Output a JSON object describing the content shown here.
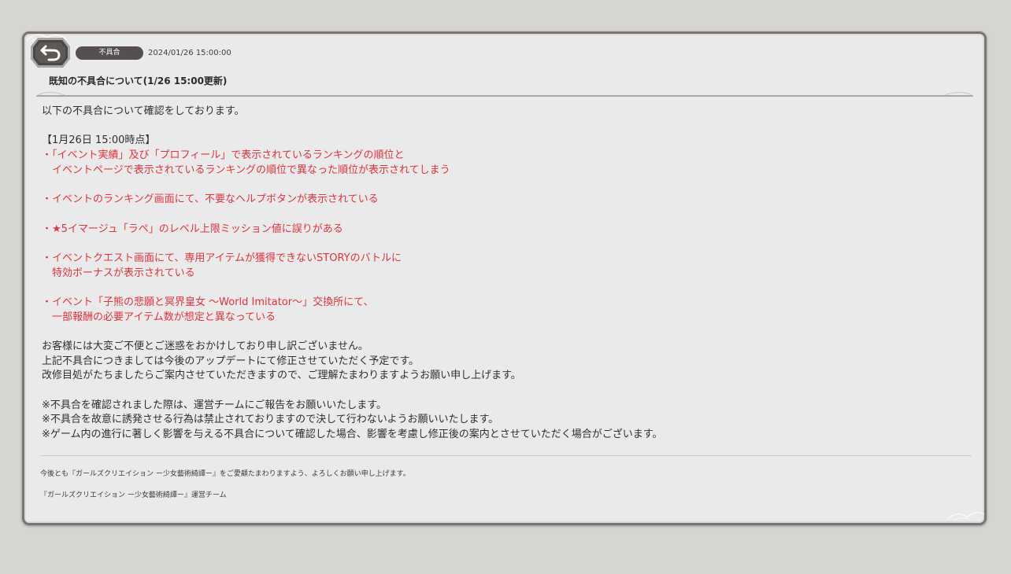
{
  "header": {
    "category_badge": "不具合",
    "date": "2024/01/26 15:00:00",
    "title": "既知の不具合について(1/26 15:00更新)"
  },
  "body": {
    "lines": [
      {
        "text": "以下の不具合について確認をしております。",
        "style": "normal"
      },
      {
        "text": "",
        "style": "normal"
      },
      {
        "text": "【1月26日 15:00時点】",
        "style": "normal"
      },
      {
        "text": "・「イベント実績」及び「プロフィール」で表示されているランキングの順位と",
        "style": "red"
      },
      {
        "text": "　イベントページで表示されているランキングの順位で異なった順位が表示されてしまう",
        "style": "red"
      },
      {
        "text": "",
        "style": "normal"
      },
      {
        "text": "・イベントのランキング画面にて、不要なヘルプボタンが表示されている",
        "style": "red"
      },
      {
        "text": "",
        "style": "normal"
      },
      {
        "text": "・★5イマージュ「ラペ」のレベル上限ミッション値に誤りがある",
        "style": "red"
      },
      {
        "text": "",
        "style": "normal"
      },
      {
        "text": "・イベントクエスト画面にて、専用アイテムが獲得できないSTORYのバトルに",
        "style": "red"
      },
      {
        "text": "　特効ボーナスが表示されている",
        "style": "red"
      },
      {
        "text": "",
        "style": "normal"
      },
      {
        "text": "・イベント「子熊の悲願と冥界皇女 〜World Imitator〜」交換所にて、",
        "style": "red"
      },
      {
        "text": "　一部報酬の必要アイテム数が想定と異なっている",
        "style": "red"
      },
      {
        "text": "",
        "style": "normal"
      },
      {
        "text": "お客様には大変ご不便とご迷惑をおかけしており申し訳ございません。",
        "style": "normal"
      },
      {
        "text": "上記不具合につきましては今後のアップデートにて修正させていただく予定です。",
        "style": "normal"
      },
      {
        "text": "改修目処がたちましたらご案内させていただきますので、ご理解たまわりますようお願い申し上げます。",
        "style": "normal"
      },
      {
        "text": "",
        "style": "normal"
      },
      {
        "text": "※不具合を確認されました際は、運営チームにご報告をお願いいたします。",
        "style": "normal"
      },
      {
        "text": "※不具合を故意に誘発させる行為は禁止されておりますので決して行わないようお願いいたします。",
        "style": "normal"
      },
      {
        "text": "※ゲーム内の進行に著しく影響を与える不具合について確認した場合、影響を考慮し修正後の案内とさせていただく場合がございます。",
        "style": "normal"
      }
    ]
  },
  "footer": {
    "closing": "今後とも『ガールズクリエイション ー少女藝術綺譚ー』をご愛顧たまわりますよう、よろしくお願い申し上げます。",
    "signature": "『ガールズクリエイション ー少女藝術綺譚ー』運営チーム"
  },
  "colors": {
    "highlight": "#e3333d",
    "text": "#2f2f2f",
    "badge": "#55504f",
    "panel_border": "#7b7571"
  },
  "icons": {
    "back": "back-arrow-icon"
  }
}
